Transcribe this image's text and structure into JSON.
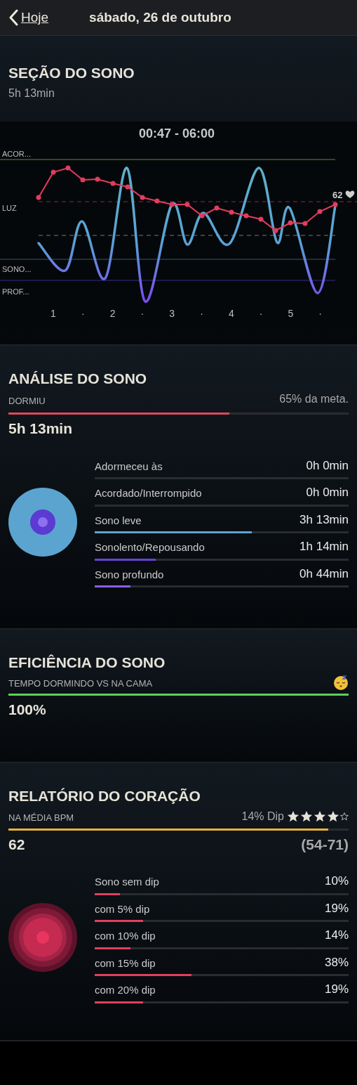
{
  "header": {
    "back_label": "Hoje",
    "title": "sábado, 26 de outubro"
  },
  "sleep_session": {
    "title": "SEÇÃO DO SONO",
    "duration": "5h 13min",
    "time_range": "00:47 - 06:00",
    "stage_labels": [
      "ACOR...",
      "LUZ",
      "SONO...",
      "PROF..."
    ],
    "hour_labels": [
      "1",
      "·",
      "2",
      "·",
      "3",
      "·",
      "4",
      "·",
      "5",
      "·"
    ],
    "heart_rate_label": "62"
  },
  "sleep_analysis": {
    "title": "ANÁLISE DO SONO",
    "label": "DORMIU",
    "goal_text": "65% da meta.",
    "level": 0.65,
    "total": "5h 13min",
    "stages": [
      {
        "name": "Adormeceu às",
        "value": "0h 0min",
        "level": 0
      },
      {
        "name": "Acordado/Interrompido",
        "value": "0h 0min",
        "level": 0
      },
      {
        "name": "Sono leve",
        "value": "3h 13min",
        "level": 0.62,
        "color": "#5ba4d0"
      },
      {
        "name": "Sonolento/Repousando",
        "value": "1h 14min",
        "level": 0.24,
        "color": "#6a3fd6"
      },
      {
        "name": "Sono profundo",
        "value": "0h 44min",
        "level": 0.14,
        "color": "#8a5cf0"
      }
    ]
  },
  "sleep_efficiency": {
    "title": "EFICIÊNCIA DO SONO",
    "label": "TEMPO DORMINDO VS NA CAMA",
    "level": 1,
    "value": "100%"
  },
  "heart_report": {
    "title": "RELATÓRIO DO CORAÇÃO",
    "label": "NA MÉDIA BPM",
    "dip": "14% Dip",
    "stars": 4,
    "level": 0.94,
    "value": "62",
    "range": "(54-71)",
    "dips": [
      {
        "name": "Sono sem dip",
        "value": "10%",
        "level": 0.1
      },
      {
        "name": "com 5% dip",
        "value": "19%",
        "level": 0.19
      },
      {
        "name": "com 10% dip",
        "value": "14%",
        "level": 0.14
      },
      {
        "name": "com 15% dip",
        "value": "38%",
        "level": 0.38
      },
      {
        "name": "com 20% dip",
        "value": "19%",
        "level": 0.19
      }
    ]
  }
}
